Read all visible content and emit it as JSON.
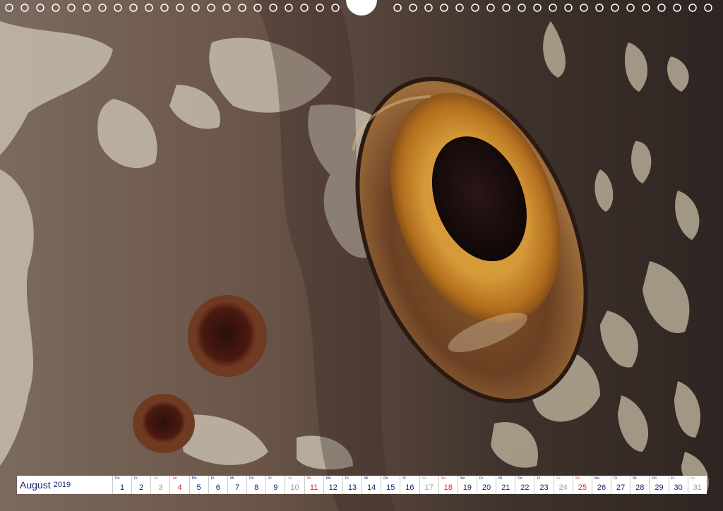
{
  "calendar": {
    "month": "August",
    "year": "2019",
    "days": [
      {
        "abbr": "Do",
        "num": "1",
        "type": "weekday"
      },
      {
        "abbr": "Fr",
        "num": "2",
        "type": "weekday"
      },
      {
        "abbr": "Sa",
        "num": "3",
        "type": "saturday"
      },
      {
        "abbr": "So",
        "num": "4",
        "type": "sunday"
      },
      {
        "abbr": "Mo",
        "num": "5",
        "type": "weekday"
      },
      {
        "abbr": "Di",
        "num": "6",
        "type": "weekday"
      },
      {
        "abbr": "Mi",
        "num": "7",
        "type": "weekday"
      },
      {
        "abbr": "Do",
        "num": "8",
        "type": "weekday"
      },
      {
        "abbr": "Fr",
        "num": "9",
        "type": "weekday"
      },
      {
        "abbr": "Sa",
        "num": "10",
        "type": "saturday"
      },
      {
        "abbr": "So",
        "num": "11",
        "type": "sunday"
      },
      {
        "abbr": "Mo",
        "num": "12",
        "type": "weekday"
      },
      {
        "abbr": "Di",
        "num": "13",
        "type": "weekday"
      },
      {
        "abbr": "Mi",
        "num": "14",
        "type": "weekday"
      },
      {
        "abbr": "Do",
        "num": "15",
        "type": "weekday"
      },
      {
        "abbr": "Fr",
        "num": "16",
        "type": "weekday"
      },
      {
        "abbr": "Sa",
        "num": "17",
        "type": "saturday"
      },
      {
        "abbr": "So",
        "num": "18",
        "type": "sunday"
      },
      {
        "abbr": "Mo",
        "num": "19",
        "type": "weekday"
      },
      {
        "abbr": "Di",
        "num": "20",
        "type": "weekday"
      },
      {
        "abbr": "Mi",
        "num": "21",
        "type": "weekday"
      },
      {
        "abbr": "Do",
        "num": "22",
        "type": "weekday"
      },
      {
        "abbr": "Fr",
        "num": "23",
        "type": "weekday"
      },
      {
        "abbr": "Sa",
        "num": "24",
        "type": "saturday"
      },
      {
        "abbr": "So",
        "num": "25",
        "type": "sunday"
      },
      {
        "abbr": "Mo",
        "num": "26",
        "type": "weekday"
      },
      {
        "abbr": "Di",
        "num": "27",
        "type": "weekday"
      },
      {
        "abbr": "Mi",
        "num": "28",
        "type": "weekday"
      },
      {
        "abbr": "Do",
        "num": "29",
        "type": "weekday"
      },
      {
        "abbr": "Fr",
        "num": "30",
        "type": "weekday"
      },
      {
        "abbr": "Sa",
        "num": "31",
        "type": "saturday"
      }
    ]
  },
  "colors": {
    "text": "#1e1e6e",
    "sunday": "#e8232a",
    "saturday": "#9a9a9a",
    "iris": "#c98a1c",
    "skin_dark": "#4a3830",
    "skin_light": "#c9c0aa"
  },
  "photo": {
    "subject": "fish-eye-closeup"
  }
}
